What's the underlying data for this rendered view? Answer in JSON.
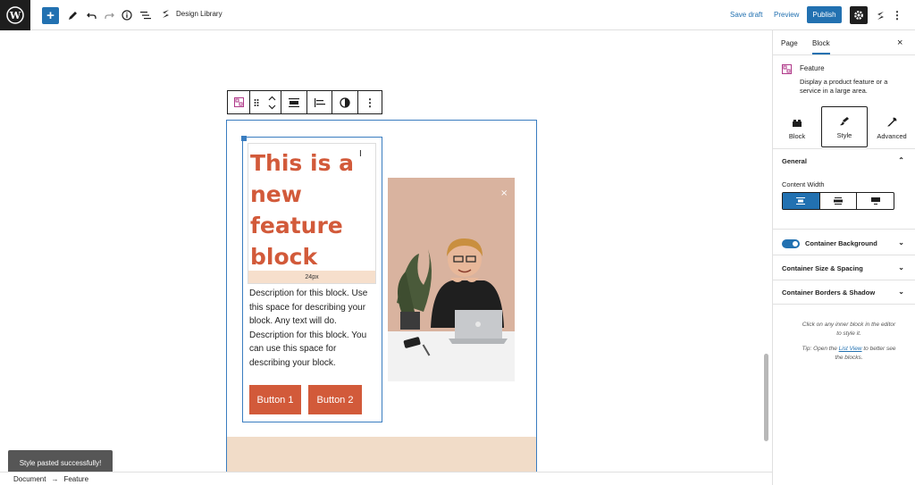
{
  "toolbar": {
    "add_label": "+",
    "doc_title": "Design Library",
    "save_draft": "Save draft",
    "preview": "Preview",
    "publish": "Publish"
  },
  "block_toolbar": {
    "icons": [
      "feature-block-icon",
      "drag-handle-icon",
      "move-up-down-icon",
      "align-full-icon",
      "text-align-icon",
      "style-icon",
      "more-options-icon"
    ]
  },
  "feature_block": {
    "heading_lines": [
      "This is a",
      "new",
      "feature",
      "block"
    ],
    "spacing_label": "24px",
    "description": "Description for this block. Use this space for describing your block. Any text will do. Description for this block. You can use this space for describing your block.",
    "button1": "Button 1",
    "button2": "Button 2",
    "accent_color": "#d25a3a"
  },
  "toast": {
    "message": "Style pasted successfully!"
  },
  "breadcrumb": {
    "item1": "Document",
    "separator": "→",
    "item2": "Feature"
  },
  "sidebar": {
    "tab_page": "Page",
    "tab_block": "Block",
    "block_name": "Feature",
    "block_desc": "Display a product feature or a service in a large area.",
    "subtabs": [
      "Block",
      "Style",
      "Advanced"
    ],
    "general": "General",
    "content_width": "Content Width",
    "container_background": "Container Background",
    "container_size": "Container Size & Spacing",
    "container_borders": "Container Borders & Shadow",
    "help1": "Click on any inner block in the editor to style it.",
    "help2_pre": "Tip: Open the",
    "help2_link": "List View",
    "help2_post": "to better see the blocks."
  }
}
